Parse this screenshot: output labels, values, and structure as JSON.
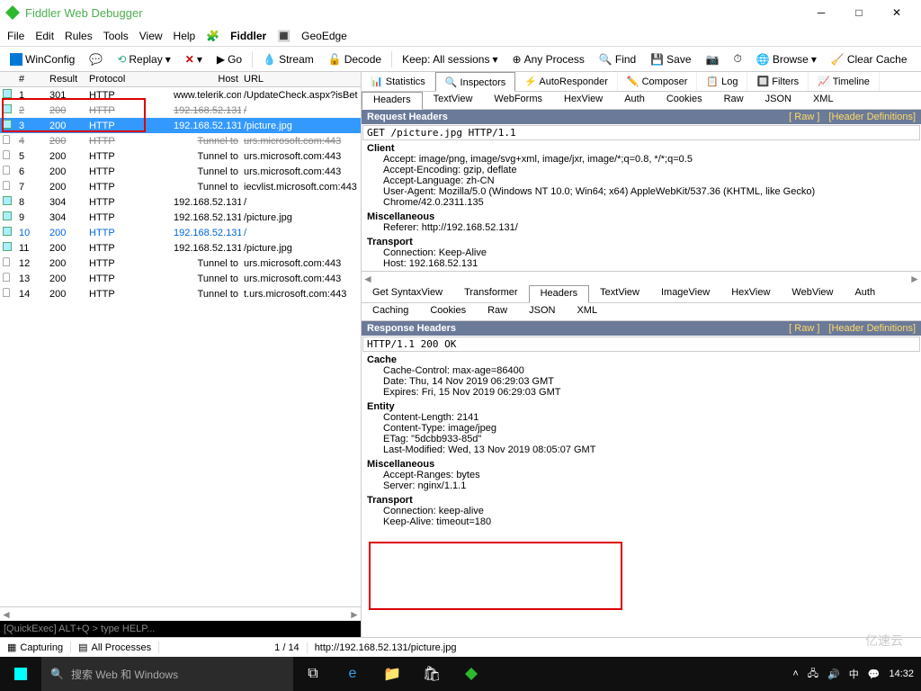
{
  "window": {
    "title": "Fiddler Web Debugger"
  },
  "menu": [
    "File",
    "Edit",
    "Rules",
    "Tools",
    "View",
    "Help",
    "Fiddler",
    "GeoEdge"
  ],
  "toolbar": {
    "winconfig": "WinConfig",
    "replay": "Replay",
    "go": "Go",
    "stream": "Stream",
    "decode": "Decode",
    "keep": "Keep: All sessions",
    "anyprocess": "Any Process",
    "find": "Find",
    "save": "Save",
    "browse": "Browse",
    "clearcache": "Clear Cache"
  },
  "sessions": {
    "cols": {
      "num": "#",
      "result": "Result",
      "protocol": "Protocol",
      "host": "Host",
      "url": "URL"
    },
    "rows": [
      {
        "n": "1",
        "r": "301",
        "p": "HTTP",
        "h": "www.telerik.com",
        "u": "/UpdateCheck.aspx?isBet",
        "sel": false,
        "strike": false
      },
      {
        "n": "2",
        "r": "200",
        "p": "HTTP",
        "h": "192.168.52.131",
        "u": "/",
        "sel": false,
        "strike": true
      },
      {
        "n": "3",
        "r": "200",
        "p": "HTTP",
        "h": "192.168.52.131",
        "u": "/picture.jpg",
        "sel": true,
        "strike": false
      },
      {
        "n": "4",
        "r": "200",
        "p": "HTTP",
        "h": "Tunnel to",
        "u": "urs.microsoft.com:443",
        "sel": false,
        "strike": true
      },
      {
        "n": "5",
        "r": "200",
        "p": "HTTP",
        "h": "Tunnel to",
        "u": "urs.microsoft.com:443",
        "sel": false,
        "strike": false
      },
      {
        "n": "6",
        "r": "200",
        "p": "HTTP",
        "h": "Tunnel to",
        "u": "urs.microsoft.com:443",
        "sel": false,
        "strike": false
      },
      {
        "n": "7",
        "r": "200",
        "p": "HTTP",
        "h": "Tunnel to",
        "u": "iecvlist.microsoft.com:443",
        "sel": false,
        "strike": false
      },
      {
        "n": "8",
        "r": "304",
        "p": "HTTP",
        "h": "192.168.52.131",
        "u": "/",
        "sel": false,
        "strike": false
      },
      {
        "n": "9",
        "r": "304",
        "p": "HTTP",
        "h": "192.168.52.131",
        "u": "/picture.jpg",
        "sel": false,
        "strike": false
      },
      {
        "n": "10",
        "r": "200",
        "p": "HTTP",
        "h": "192.168.52.131",
        "u": "/",
        "sel": false,
        "strike": false,
        "blue": true
      },
      {
        "n": "11",
        "r": "200",
        "p": "HTTP",
        "h": "192.168.52.131",
        "u": "/picture.jpg",
        "sel": false,
        "strike": false
      },
      {
        "n": "12",
        "r": "200",
        "p": "HTTP",
        "h": "Tunnel to",
        "u": "urs.microsoft.com:443",
        "sel": false,
        "strike": false
      },
      {
        "n": "13",
        "r": "200",
        "p": "HTTP",
        "h": "Tunnel to",
        "u": "urs.microsoft.com:443",
        "sel": false,
        "strike": false
      },
      {
        "n": "14",
        "r": "200",
        "p": "HTTP",
        "h": "Tunnel to",
        "u": "t.urs.microsoft.com:443",
        "sel": false,
        "strike": false
      }
    ]
  },
  "quickexec": "[QuickExec] ALT+Q > type HELP...",
  "righttabs": [
    "Statistics",
    "Inspectors",
    "AutoResponder",
    "Composer",
    "Log",
    "Filters",
    "Timeline"
  ],
  "righttabs_active": 1,
  "reqtabs": [
    "Headers",
    "TextView",
    "WebForms",
    "HexView",
    "Auth",
    "Cookies",
    "Raw",
    "JSON",
    "XML"
  ],
  "reqtabs_active": 0,
  "reqheader": {
    "title": "Request Headers",
    "raw": "[ Raw ]",
    "defs": "[Header Definitions]"
  },
  "reqraw": "GET /picture.jpg HTTP/1.1",
  "reqgroups": [
    {
      "name": "Client",
      "items": [
        "Accept: image/png, image/svg+xml, image/jxr, image/*;q=0.8, */*;q=0.5",
        "Accept-Encoding: gzip, deflate",
        "Accept-Language: zh-CN",
        "User-Agent: Mozilla/5.0 (Windows NT 10.0; Win64; x64) AppleWebKit/537.36 (KHTML, like Gecko) Chrome/42.0.2311.135"
      ]
    },
    {
      "name": "Miscellaneous",
      "items": [
        "Referer: http://192.168.52.131/"
      ]
    },
    {
      "name": "Transport",
      "items": [
        "Connection: Keep-Alive",
        "Host: 192.168.52.131"
      ]
    }
  ],
  "resptabs1": [
    "Get SyntaxView",
    "Transformer",
    "Headers",
    "TextView",
    "ImageView",
    "HexView",
    "WebView",
    "Auth"
  ],
  "resptabs1_active": 2,
  "resptabs2": [
    "Caching",
    "Cookies",
    "Raw",
    "JSON",
    "XML"
  ],
  "respheader": {
    "title": "Response Headers",
    "raw": "[ Raw ]",
    "defs": "[Header Definitions]"
  },
  "respraw": "HTTP/1.1 200 OK",
  "respgroups": [
    {
      "name": "Cache",
      "items": [
        "Cache-Control: max-age=86400",
        "Date: Thu, 14 Nov 2019 06:29:03 GMT",
        "Expires: Fri, 15 Nov 2019 06:29:03 GMT"
      ]
    },
    {
      "name": "Entity",
      "items": [
        "Content-Length: 2141",
        "Content-Type: image/jpeg",
        "ETag: \"5dcbb933-85d\"",
        "Last-Modified: Wed, 13 Nov 2019 08:05:07 GMT"
      ]
    },
    {
      "name": "Miscellaneous",
      "items": [
        "Accept-Ranges: bytes",
        "Server: nginx/1.1.1"
      ]
    },
    {
      "name": "Transport",
      "items": [
        "Connection: keep-alive",
        "Keep-Alive: timeout=180"
      ]
    }
  ],
  "status": {
    "capturing": "Capturing",
    "processes": "All Processes",
    "count": "1 / 14",
    "url": "http://192.168.52.131/picture.jpg"
  },
  "taskbar": {
    "search": "搜索 Web 和 Windows",
    "time": "14:32"
  },
  "watermark": "亿速云"
}
